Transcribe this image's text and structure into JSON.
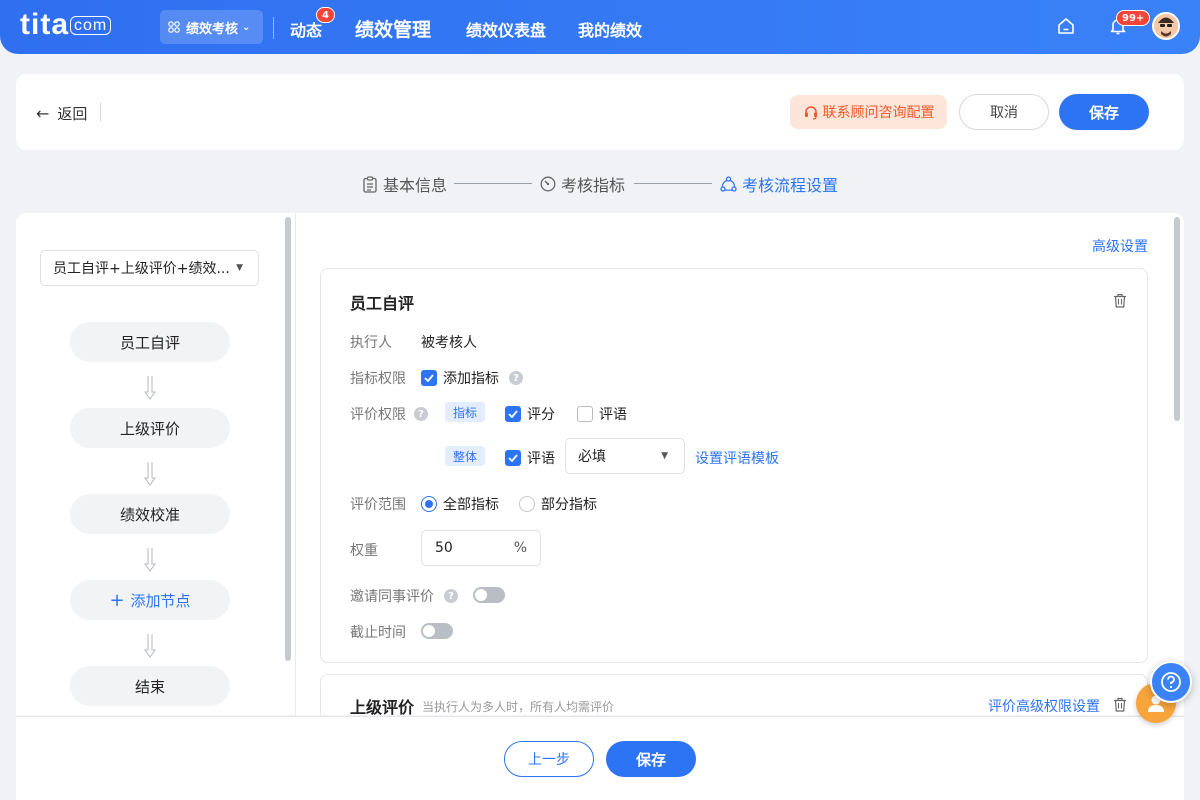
{
  "topbar": {
    "logo": "tita",
    "logo_suffix": "com",
    "module_label": "绩效考核",
    "nav": [
      {
        "label": "动态",
        "badge": "4"
      },
      {
        "label": "绩效管理"
      },
      {
        "label": "绩效仪表盘"
      },
      {
        "label": "我的绩效"
      }
    ],
    "notification_badge": "99+",
    "icons": [
      "home-icon",
      "bell-icon",
      "avatar"
    ]
  },
  "header": {
    "back_label": "返回",
    "consult_label": "联系顾问咨询配置",
    "cancel_label": "取消",
    "save_label": "保存"
  },
  "steps": [
    {
      "label": "基本信息",
      "active": false,
      "icon": "clipboard-icon"
    },
    {
      "label": "考核指标",
      "active": false,
      "icon": "gauge-icon"
    },
    {
      "label": "考核流程设置",
      "active": true,
      "icon": "flow-icon"
    }
  ],
  "flow": {
    "selected_template": "员工自评+上级评价+绩效...",
    "nodes": [
      "员工自评",
      "上级评价",
      "绩效校准"
    ],
    "add_node_label": "添加节点",
    "end_label": "结束"
  },
  "main": {
    "advanced_link": "高级设置",
    "self_review": {
      "title": "员工自评",
      "executor_label": "执行人",
      "executor_value": "被考核人",
      "indicator_perm_label": "指标权限",
      "add_indicator_label": "添加指标",
      "add_indicator_checked": true,
      "review_perm_label": "评价权限",
      "indicator_tag": "指标",
      "score_label": "评分",
      "score_checked": true,
      "comment_label": "评语",
      "comment_checked": false,
      "overall_tag": "整体",
      "overall_comment_label": "评语",
      "overall_comment_checked": true,
      "required_value": "必填",
      "template_link": "设置评语模板",
      "scope_label": "评价范围",
      "scope_options": [
        "全部指标",
        "部分指标"
      ],
      "scope_selected": "全部指标",
      "weight_label": "权重",
      "weight_value": "50",
      "weight_unit": "%",
      "invite_label": "邀请同事评价",
      "invite_on": false,
      "deadline_label": "截止时间",
      "deadline_on": false
    },
    "manager_review": {
      "title": "上级评价",
      "hint": "当执行人为多人时，所有人均需评价",
      "perm_link": "评价高级权限设置"
    }
  },
  "footer": {
    "prev_label": "上一步",
    "save_label": "保存"
  },
  "colors": {
    "primary": "#2d74f5",
    "topbar": "#3a82f8",
    "consult_bg": "#fde6d9",
    "consult_text": "#f2582c"
  }
}
